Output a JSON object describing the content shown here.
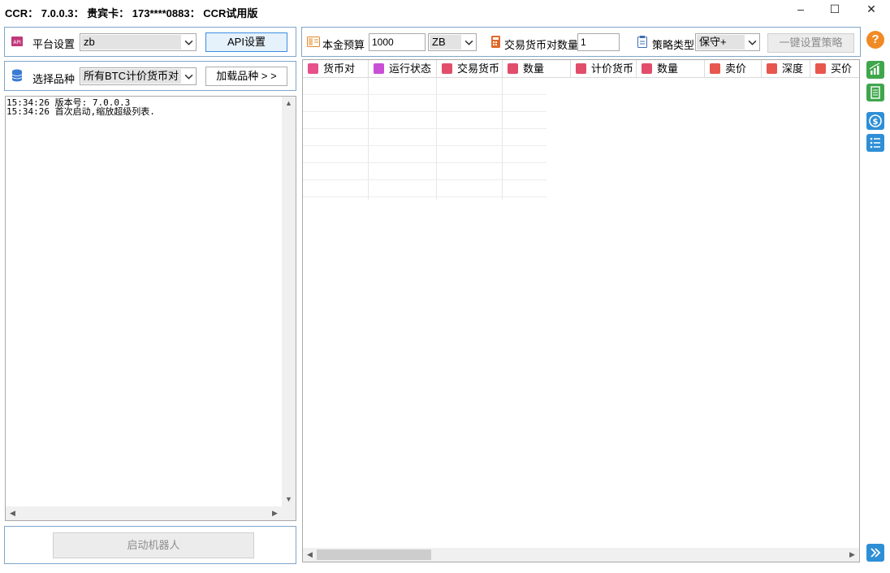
{
  "window": {
    "title": "CCR： 7.0.0.3： 贵宾卡： 173****0883： CCR试用版",
    "controls": {
      "minimize": "–",
      "maximize": "☐",
      "close": "✕"
    }
  },
  "left": {
    "platform": {
      "label": "平台设置",
      "value": "zb",
      "api_button": "API设置"
    },
    "variety": {
      "label": "选择品种",
      "value": "所有BTC计价货币对",
      "load_button": "加载品种 > >"
    },
    "log_lines": [
      "15:34:26 版本号: 7.0.0.3",
      "15:34:26 首次启动,缩放超级列表."
    ],
    "start_button": "启动机器人"
  },
  "toolbar": {
    "budget_label": "本金预算",
    "budget_value": "1000",
    "currency_value": "ZB",
    "pair_count_label": "交易货币对数量",
    "pair_count_value": "1",
    "strategy_label": "策略类型",
    "strategy_value": "保守+",
    "set_strategy_button": "一键设置策略"
  },
  "table": {
    "columns": [
      {
        "label": "货币对",
        "icon": "bitcoin-icon",
        "color": "#e8508a"
      },
      {
        "label": "运行状态",
        "icon": "monitor-icon",
        "color": "#c94fd6"
      },
      {
        "label": "交易货币",
        "icon": "cube-icon",
        "color": "#e24d6b"
      },
      {
        "label": "数量",
        "icon": "cube-icon",
        "color": "#e24d6b"
      },
      {
        "label": "计价货币",
        "icon": "cube-icon",
        "color": "#e24d6b"
      },
      {
        "label": "数量",
        "icon": "cube-icon",
        "color": "#e24d6b"
      },
      {
        "label": "卖价",
        "icon": "list-icon",
        "color": "#e8574e"
      },
      {
        "label": "深度",
        "icon": "list-icon",
        "color": "#e8574e"
      },
      {
        "label": "买价",
        "icon": "list-icon",
        "color": "#e8574e"
      }
    ],
    "rows": []
  },
  "side_icons": {
    "help": "?",
    "colors": {
      "help": "#f08a24",
      "chart": "#3fa64c",
      "document": "#3fa64c",
      "coin": "#2e8fd6",
      "list": "#2e8fd6",
      "expand": "#2e8fd6"
    }
  }
}
